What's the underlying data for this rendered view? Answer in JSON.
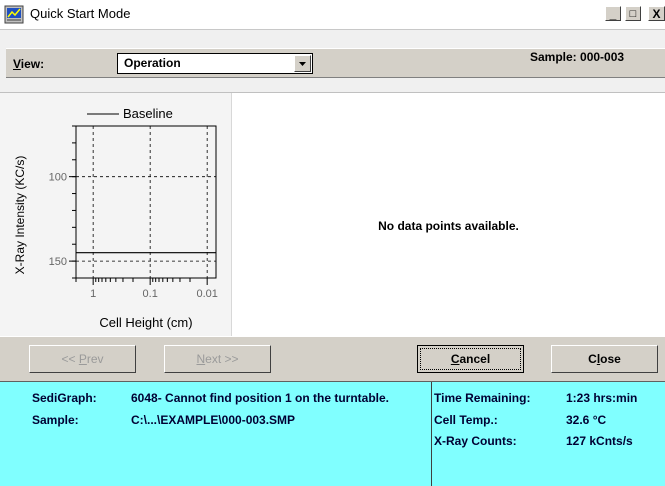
{
  "window": {
    "title": "Quick Start Mode",
    "controls": {
      "minimize": "_",
      "maximize": "□",
      "close": "X"
    }
  },
  "view": {
    "label": "View:",
    "selected": "Operation",
    "sample": "Sample: 000-003"
  },
  "chart_data": {
    "type": "line",
    "legend": "Baseline",
    "ylabel": "X-Ray Intensity (KC/s)",
    "xlabel": "Cell Height (cm)",
    "x_scale": "log, reversed",
    "x_ticks": [
      "1",
      "0.1",
      "0.01"
    ],
    "y_ticks": [
      "100",
      "150"
    ],
    "xlim": [
      2,
      0.007
    ],
    "ylim": [
      70,
      160
    ],
    "grid": true,
    "series": [
      {
        "name": "Baseline",
        "x": [
          2,
          0.007
        ],
        "y": [
          145,
          145
        ]
      }
    ]
  },
  "main": {
    "message": "No data points available."
  },
  "buttons": {
    "prev": "<< Prev",
    "next": "Next >>",
    "cancel": "Cancel",
    "close": "Close"
  },
  "status": {
    "sedigraph_label": "SediGraph:",
    "sedigraph_value": "6048-  Cannot find position 1 on the turntable.",
    "sample_label": "Sample:",
    "sample_value": "C:\\...\\EXAMPLE\\000-003.SMP",
    "time_label": "Time Remaining:",
    "time_value": "1:23 hrs:min",
    "temp_label": "Cell Temp.:",
    "temp_value": "32.6 °C",
    "counts_label": "X-Ray Counts:",
    "counts_value": "127 kCnts/s"
  },
  "colors": {
    "status_bg": "#80ffff",
    "chrome": "#d4d0c8"
  }
}
